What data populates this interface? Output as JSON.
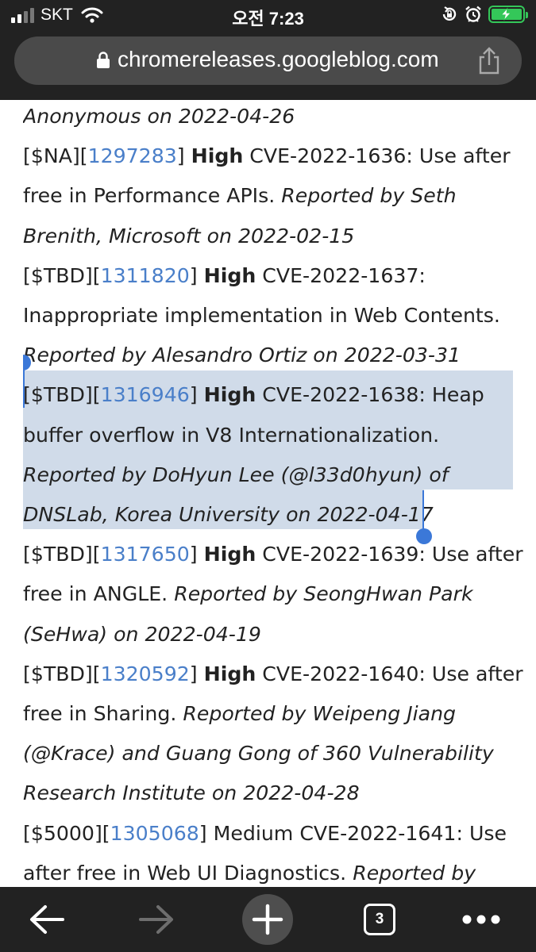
{
  "status_bar": {
    "carrier": "SKT",
    "time": "오전 7:23"
  },
  "browser": {
    "url": "chromereleases.googleblog.com",
    "tab_count": "3"
  },
  "content": {
    "lines": [
      [
        {
          "t": "Anonymous on 2022-04-26",
          "s": "it"
        }
      ],
      [
        {
          "t": "[$NA][",
          "s": ""
        },
        {
          "t": "1297283",
          "s": "lnk"
        },
        {
          "t": "] ",
          "s": ""
        },
        {
          "t": "High",
          "s": "b"
        },
        {
          "t": " CVE-2022-1636: Use after",
          "s": ""
        }
      ],
      [
        {
          "t": "free in Performance APIs. ",
          "s": ""
        },
        {
          "t": "Reported by Seth",
          "s": "it"
        }
      ],
      [
        {
          "t": "Brenith, Microsoft on 2022-02-15",
          "s": "it"
        }
      ],
      [
        {
          "t": "[$TBD][",
          "s": ""
        },
        {
          "t": "1311820",
          "s": "lnk"
        },
        {
          "t": "] ",
          "s": ""
        },
        {
          "t": "High",
          "s": "b"
        },
        {
          "t": " CVE-2022-1637:",
          "s": ""
        }
      ],
      [
        {
          "t": "Inappropriate implementation in Web Contents.",
          "s": ""
        }
      ],
      [
        {
          "t": "Reported by Alesandro Ortiz on 2022-03-31",
          "s": "it"
        }
      ],
      [
        {
          "t": "[$TBD][",
          "s": ""
        },
        {
          "t": "1316946",
          "s": "lnk"
        },
        {
          "t": "] ",
          "s": ""
        },
        {
          "t": "High",
          "s": "b"
        },
        {
          "t": " CVE-2022-1638: Heap",
          "s": ""
        }
      ],
      [
        {
          "t": "buffer overflow in V8 Internationalization.",
          "s": ""
        }
      ],
      [
        {
          "t": "Reported by DoHyun Lee (@l33d0hyun) of",
          "s": "it"
        }
      ],
      [
        {
          "t": "DNSLab, Korea University on 2022-04-17",
          "s": "it"
        }
      ],
      [
        {
          "t": "[$TBD][",
          "s": ""
        },
        {
          "t": "1317650",
          "s": "lnk"
        },
        {
          "t": "] ",
          "s": ""
        },
        {
          "t": "High",
          "s": "b"
        },
        {
          "t": " CVE-2022-1639: Use after",
          "s": ""
        }
      ],
      [
        {
          "t": "free in ANGLE. ",
          "s": ""
        },
        {
          "t": "Reported by SeongHwan Park",
          "s": "it"
        }
      ],
      [
        {
          "t": "(SeHwa) on 2022-04-19",
          "s": "it"
        }
      ],
      [
        {
          "t": "[$TBD][",
          "s": ""
        },
        {
          "t": "1320592",
          "s": "lnk"
        },
        {
          "t": "] ",
          "s": ""
        },
        {
          "t": "High",
          "s": "b"
        },
        {
          "t": " CVE-2022-1640: Use after",
          "s": ""
        }
      ],
      [
        {
          "t": "free in Sharing. ",
          "s": ""
        },
        {
          "t": "Reported by Weipeng Jiang",
          "s": "it"
        }
      ],
      [
        {
          "t": "(@Krace) and Guang Gong of 360 Vulnerability",
          "s": "it"
        }
      ],
      [
        {
          "t": "Research Institute on 2022-04-28",
          "s": "it"
        }
      ],
      [
        {
          "t": "[$5000][",
          "s": ""
        },
        {
          "t": "1305068",
          "s": "lnk"
        },
        {
          "t": "] Medium CVE-2022-1641: Use",
          "s": ""
        }
      ],
      [
        {
          "t": "after free in Web UI Diagnostics. ",
          "s": ""
        },
        {
          "t": "Reported by",
          "s": "it"
        }
      ]
    ],
    "selected_lines": [
      7,
      10
    ]
  },
  "icons": {
    "lock": "lock-icon",
    "share": "share-icon",
    "back": "arrow-left-icon",
    "forward": "arrow-right-icon",
    "new_tab": "plus-icon",
    "tabs": "tab-switcher-icon",
    "menu": "more-horizontal-icon",
    "wifi": "wifi-icon",
    "alarm": "alarm-icon",
    "rotation_lock": "rotation-lock-icon",
    "battery": "battery-charging-icon"
  },
  "colors": {
    "link": "#4a7fc9",
    "selection": "#d0dbe9",
    "selection_handle": "#3b78d8",
    "chrome_bg": "#222222",
    "battery": "#34c759"
  }
}
